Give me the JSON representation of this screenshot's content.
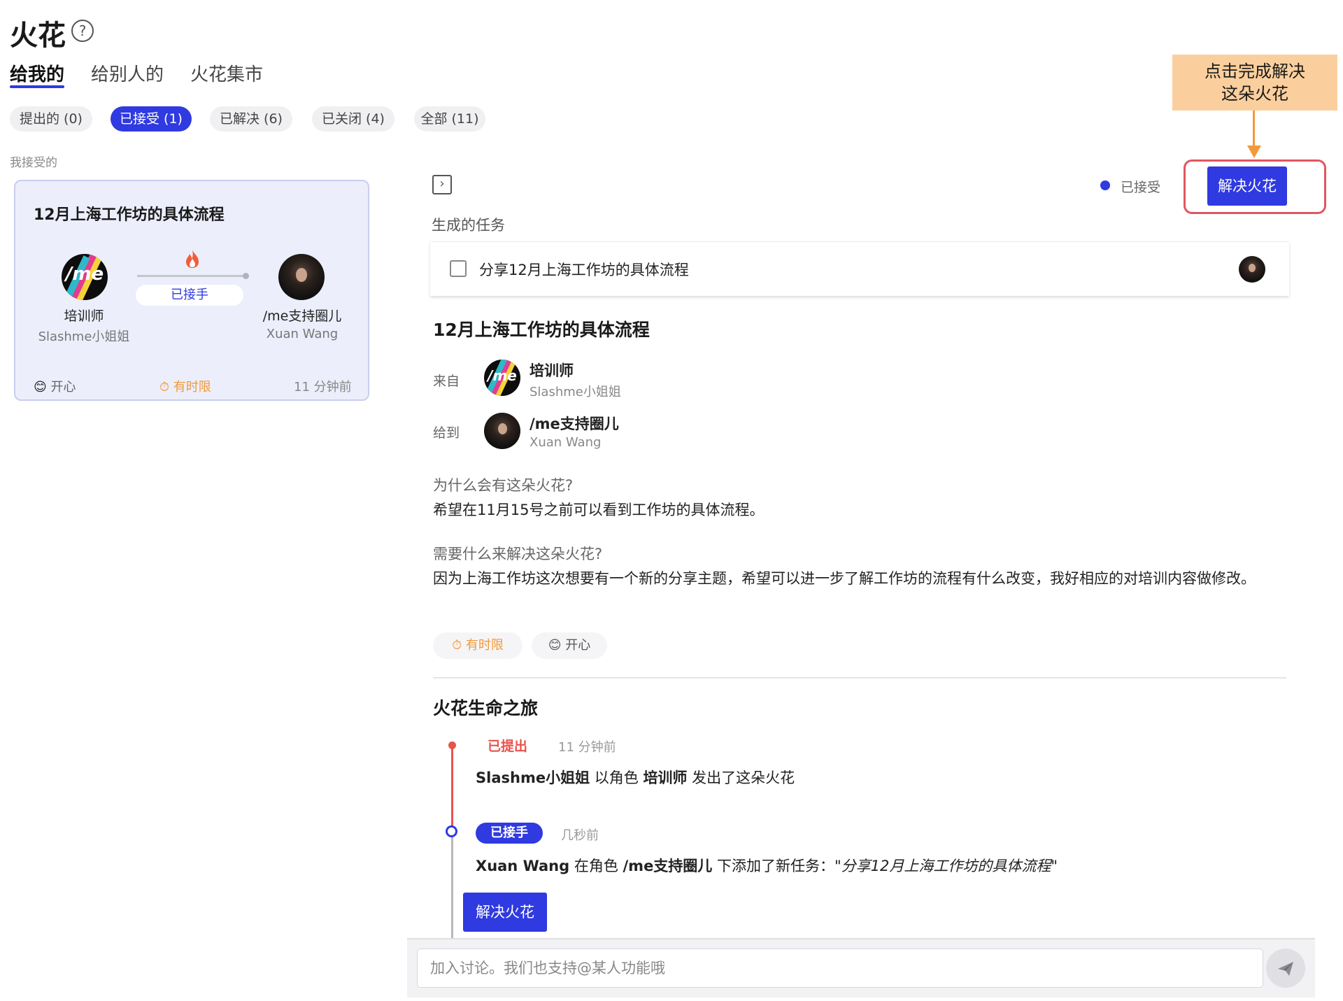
{
  "header": {
    "title": "火花",
    "help_icon": "help-circle-icon"
  },
  "main_tabs": [
    {
      "label": "给我的",
      "active": true
    },
    {
      "label": "给别人的",
      "active": false
    },
    {
      "label": "火花集市",
      "active": false
    }
  ],
  "filters": [
    {
      "label": "提出的 (0)",
      "active": false
    },
    {
      "label": "已接受 (1)",
      "active": true
    },
    {
      "label": "已解决 (6)",
      "active": false
    },
    {
      "label": "已关闭 (4)",
      "active": false
    },
    {
      "label": "全部 (11)",
      "active": false
    }
  ],
  "section_label": "我接受的",
  "card": {
    "title": "12月上海工作坊的具体流程",
    "from_role": "培训师",
    "from_user": "Slashme小姐姐",
    "to_role": "/me支持圈儿",
    "to_user": "Xuan Wang",
    "status": "已接手",
    "mood": "开心",
    "time_limit": "有时限",
    "time_ago": "11 分钟前"
  },
  "detail": {
    "status": "已接受",
    "resolve_button": "解决火花",
    "tasks_label": "生成的任务",
    "task": "分享12月上海工作坊的具体流程",
    "title": "12月上海工作坊的具体流程",
    "from_label": "来自",
    "from_role": "培训师",
    "from_user": "Slashme小姐姐",
    "to_label": "给到",
    "to_role": "/me支持圈儿",
    "to_user": "Xuan Wang",
    "why_q": "为什么会有这朵火花?",
    "why_a": "希望在11月15号之前可以看到工作坊的具体流程。",
    "need_q": "需要什么来解决这朵火花?",
    "need_a": "因为上海工作坊这次想要有一个新的分享主题，希望可以进一步了解工作坊的流程有什么改变，我好相应的对培训内容做修改。",
    "tag_time": "有时限",
    "tag_mood": "开心"
  },
  "journey": {
    "title": "火花生命之旅",
    "events": [
      {
        "badge": "已提出",
        "time": "11 分钟前",
        "actor": "Slashme小姐姐",
        "t1": " 以角色 ",
        "role": "培训师",
        "t2": " 发出了这朵火花"
      },
      {
        "badge": "已接手",
        "time": "几秒前",
        "actor": "Xuan Wang",
        "t1": " 在角色 ",
        "role": "/me支持圈儿",
        "t2": " 下添加了新任务：\"",
        "task": "分享12月上海工作坊的具体流程",
        "t3": "\""
      }
    ],
    "resolve_button": "解决火花"
  },
  "comment": {
    "placeholder": "加入讨论。我们也支持@某人功能哦",
    "send_icon": "send-icon"
  },
  "annotation": {
    "line1": "点击完成解决",
    "line2": "这朵火花"
  },
  "colors": {
    "accent": "#2f3ae0",
    "red": "#e8534b",
    "orange": "#f29a3a",
    "annotation_bg": "#fbcf9d"
  }
}
